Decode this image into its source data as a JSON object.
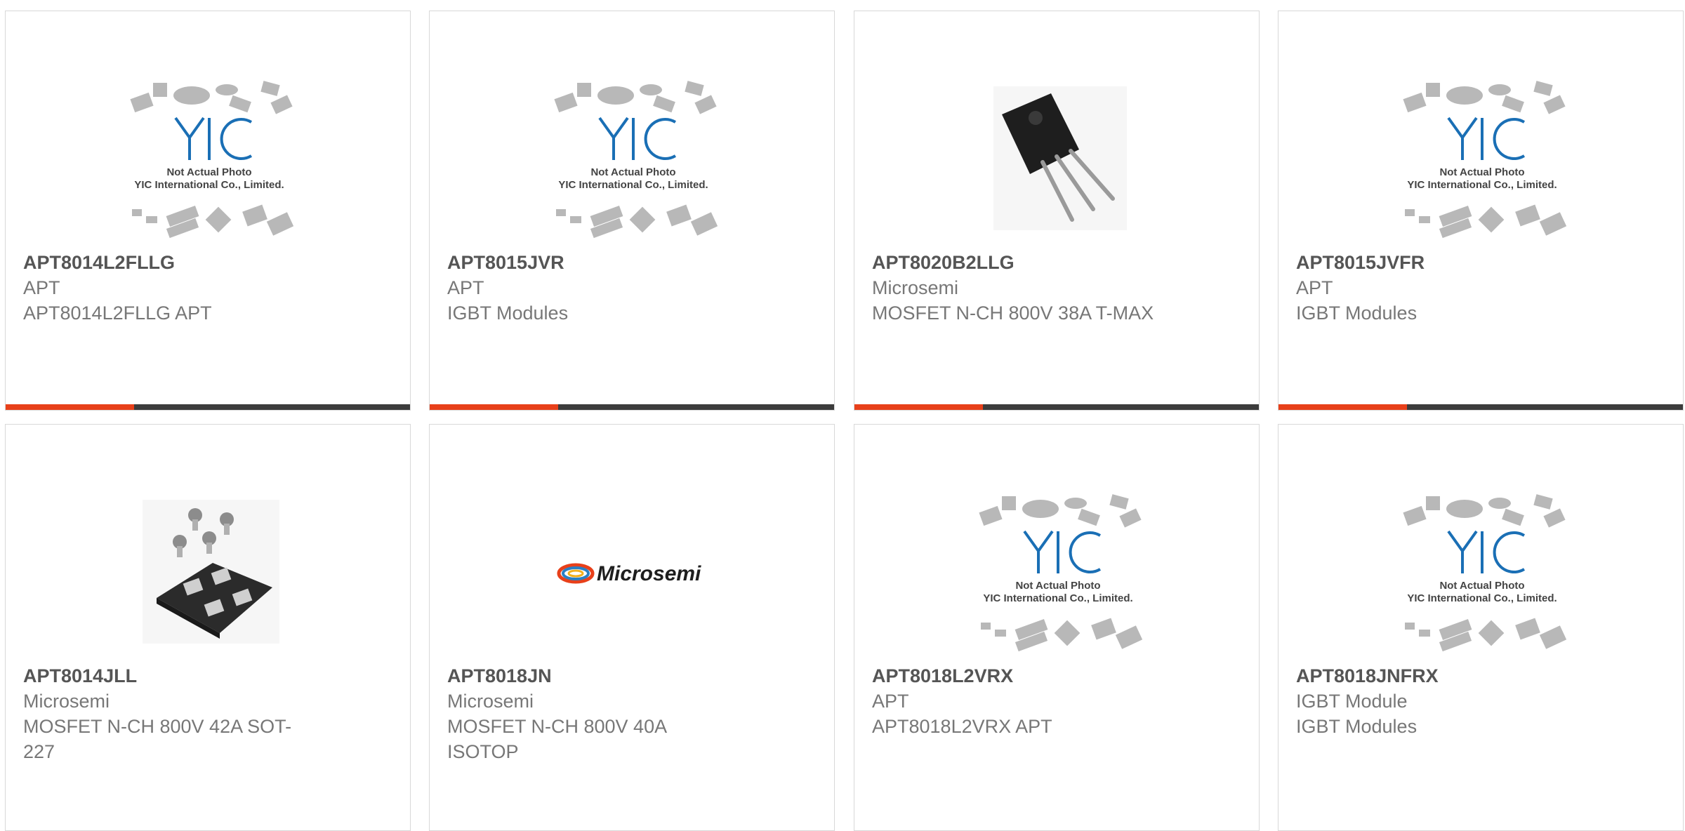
{
  "placeholder_image": {
    "logo_text": "YIC",
    "line1": "Not Actual Photo",
    "line2": "YIC International Co., Limited."
  },
  "brand_logo_text": "Microsemi",
  "colors": {
    "accent": "#e8401a",
    "bar": "#3c3c3c",
    "logo_blue": "#1a6fb5"
  },
  "products": [
    {
      "part_number": "APT8014L2FLLG",
      "manufacturer": "APT",
      "description": "APT8014L2FLLG APT",
      "image": "placeholder-photo"
    },
    {
      "part_number": "APT8015JVR",
      "manufacturer": "APT",
      "description": "IGBT Modules",
      "image": "placeholder-photo"
    },
    {
      "part_number": "APT8020B2LLG",
      "manufacturer": "Microsemi",
      "description": "MOSFET N-CH 800V 38A T-MAX",
      "image": "to247-transistor-photo"
    },
    {
      "part_number": "APT8015JVFR",
      "manufacturer": "APT",
      "description": "IGBT Modules",
      "image": "placeholder-photo"
    },
    {
      "part_number": "APT8014JLL",
      "manufacturer": "Microsemi",
      "description": "MOSFET N-CH 800V 42A SOT-227",
      "image": "sot227-module-photo"
    },
    {
      "part_number": "APT8018JN",
      "manufacturer": "Microsemi",
      "description": "MOSFET N-CH 800V 40A ISOTOP",
      "image": "microsemi-logo"
    },
    {
      "part_number": "APT8018L2VRX",
      "manufacturer": "APT",
      "description": "APT8018L2VRX APT",
      "image": "placeholder-photo"
    },
    {
      "part_number": "APT8018JNFRX",
      "manufacturer": "IGBT Module",
      "description": "IGBT Modules",
      "image": "placeholder-photo"
    }
  ]
}
